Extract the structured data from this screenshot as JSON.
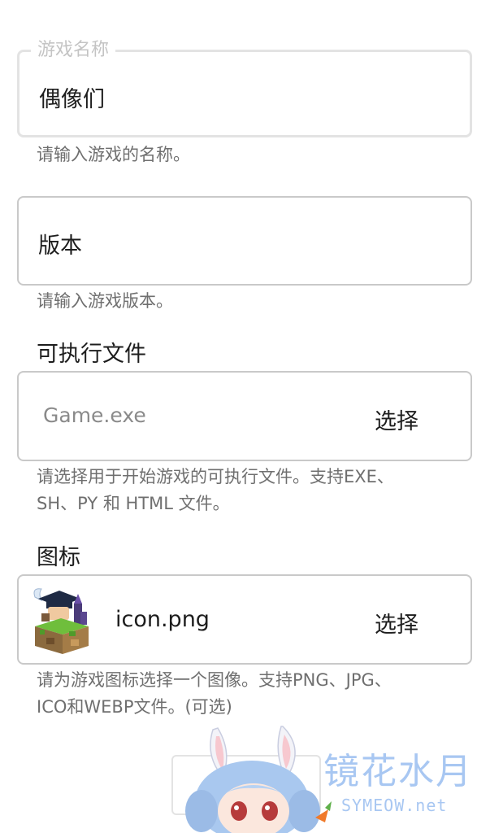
{
  "game_name": {
    "legend": "游戏名称",
    "value": "偶像们",
    "helper": "请输入游戏的名称。"
  },
  "version": {
    "value": "版本",
    "helper": "请输入游戏版本。"
  },
  "executable": {
    "label": "可执行文件",
    "value": "Game.exe",
    "choose_label": "选择",
    "helper_line1": "请选择用于开始游戏的可执行文件。支持EXE、",
    "helper_line2": "SH、PY 和 HTML 文件。"
  },
  "icon": {
    "label": "图标",
    "file": "icon.png",
    "choose_label": "选择",
    "helper_line1": "请为游戏图标选择一个图像。支持PNG、JPG、",
    "helper_line2": "ICO和WEBP文件。(可选)"
  },
  "watermark": {
    "title": "镜花水月",
    "subtitle": "SYMEOW.net"
  },
  "colors": {
    "border": "#c9c9c9",
    "helper": "#6f6f6f",
    "watermark": "#a8c7f2"
  }
}
